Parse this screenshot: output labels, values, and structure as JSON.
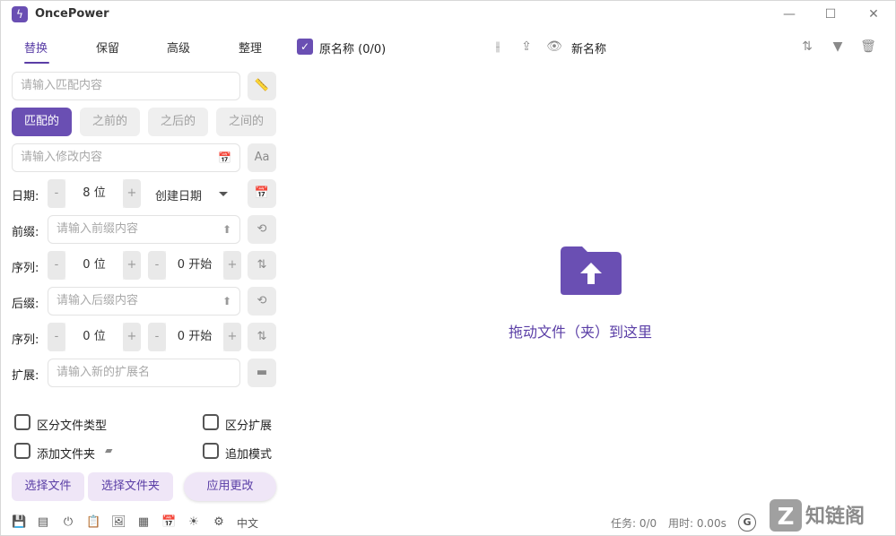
{
  "app": {
    "title": "OncePower"
  },
  "window": {
    "minimize": "—",
    "maximize": "☐",
    "close": "✕"
  },
  "tabs": [
    {
      "label": "替换",
      "active": true
    },
    {
      "label": "保留",
      "active": false
    },
    {
      "label": "高级",
      "active": false
    },
    {
      "label": "整理",
      "active": false
    }
  ],
  "replace": {
    "match_placeholder": "请输入匹配内容",
    "modes": [
      "匹配的",
      "之前的",
      "之后的",
      "之间的"
    ],
    "modify_placeholder": "请输入修改内容"
  },
  "date_row": {
    "label": "日期:",
    "value": "8 位",
    "select": "创建日期"
  },
  "prefix_row": {
    "label": "前缀:",
    "placeholder": "请输入前缀内容"
  },
  "seq1": {
    "label": "序列:",
    "digits": "0 位",
    "start": "0 开始"
  },
  "suffix_row": {
    "label": "后缀:",
    "placeholder": "请输入后缀内容"
  },
  "seq2": {
    "label": "序列:",
    "digits": "0 位",
    "start": "0 开始"
  },
  "ext_row": {
    "label": "扩展:",
    "placeholder": "请输入新的扩展名"
  },
  "options": {
    "distinguish_type": "区分文件类型",
    "distinguish_ext": "区分扩展",
    "add_folder": "添加文件夹",
    "append_mode": "追加模式"
  },
  "buttons": {
    "select_files": "选择文件",
    "select_folder": "选择文件夹",
    "apply": "应用更改"
  },
  "footer": {
    "language": "中文",
    "tasks": "任务: 0/0",
    "time": "用时: 0.00s"
  },
  "file_header": {
    "original": "原名称 (0/0)",
    "new": "新名称"
  },
  "drop": {
    "text": "拖动文件（夹）到这里"
  },
  "colors": {
    "accent": "#6a4fb3"
  }
}
